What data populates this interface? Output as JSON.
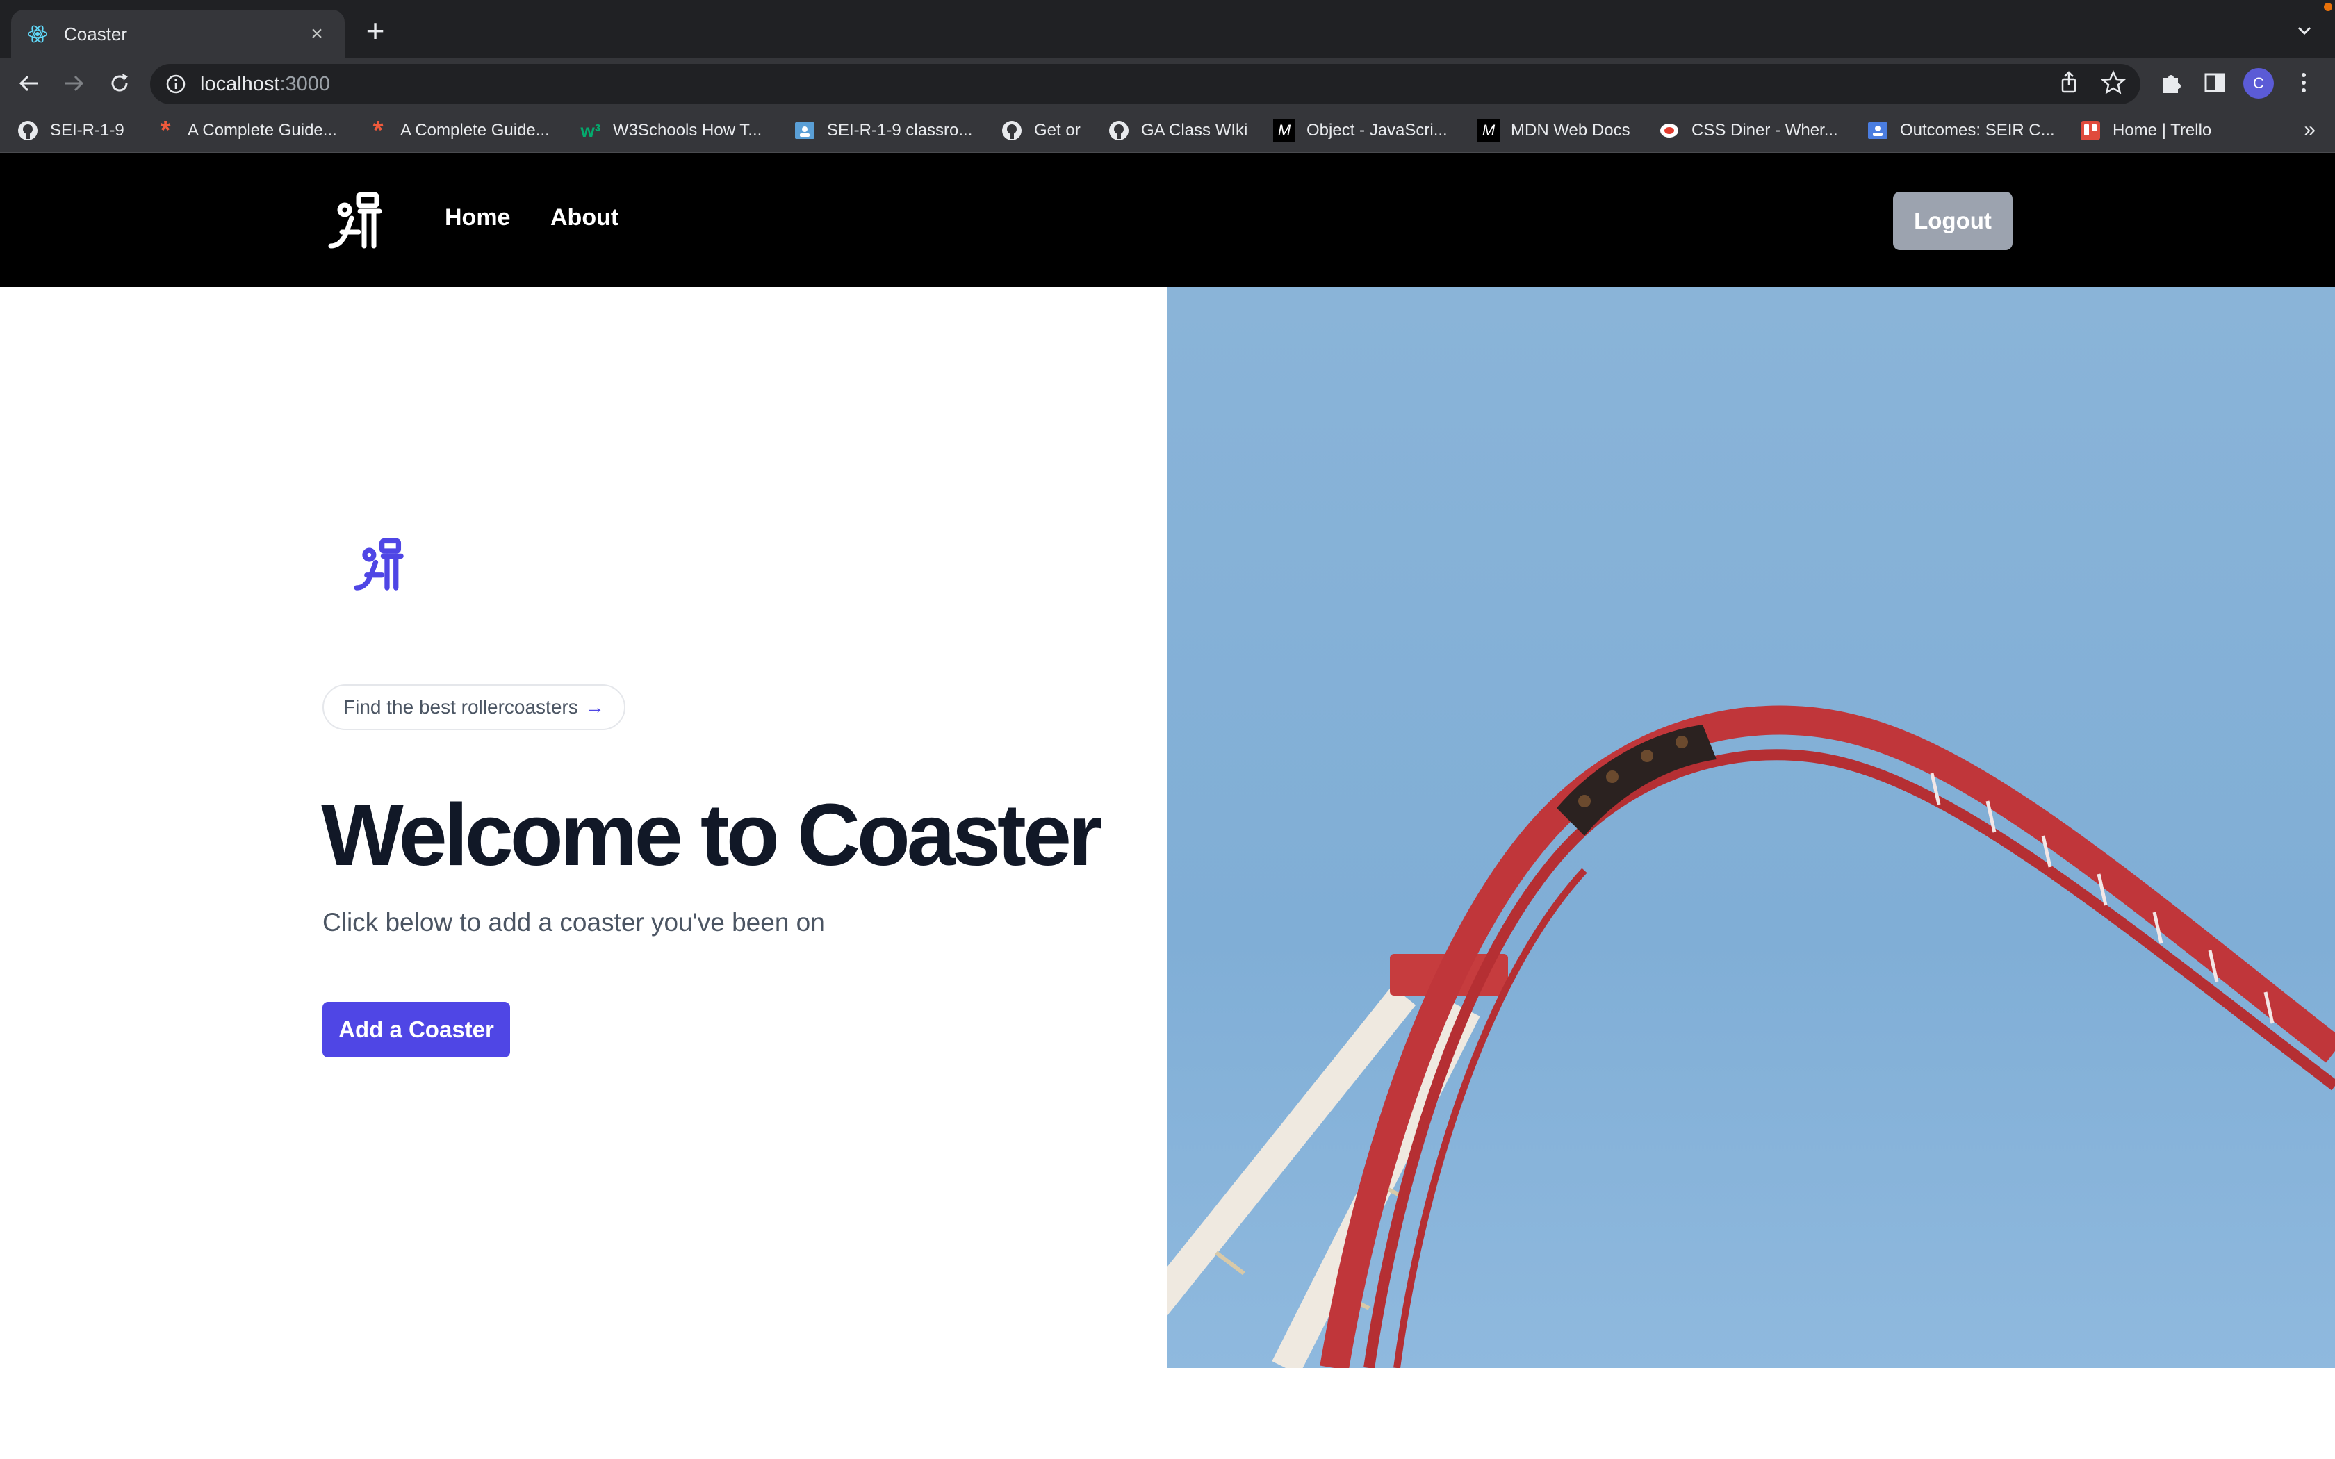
{
  "browser": {
    "tab_title": "Coaster",
    "tab_close": "×",
    "new_tab": "+",
    "url_host": "localhost",
    "url_port": ":3000",
    "profile_initial": "C",
    "bookmarks_more": "»",
    "bookmarks": [
      {
        "label": "SEI-R-1-9",
        "icon": "github-icon"
      },
      {
        "label": "A Complete Guide...",
        "icon": "asterisk-icon"
      },
      {
        "label": "A Complete Guide...",
        "icon": "asterisk-icon"
      },
      {
        "label": "W3Schools How T...",
        "icon": "w3schools-icon"
      },
      {
        "label": "SEI-R-1-9 classro...",
        "icon": "classroom-icon"
      },
      {
        "label": "Get or",
        "icon": "github-icon"
      },
      {
        "label": "GA Class WIki",
        "icon": "github-icon"
      },
      {
        "label": "Object - JavaScri...",
        "icon": "mdn-icon"
      },
      {
        "label": "MDN Web Docs",
        "icon": "mdn-icon"
      },
      {
        "label": "CSS Diner - Wher...",
        "icon": "css-diner-icon"
      },
      {
        "label": "Outcomes: SEIR C...",
        "icon": "outcomes-icon"
      },
      {
        "label": "Home | Trello",
        "icon": "trello-icon"
      }
    ]
  },
  "nav": {
    "links": [
      "Home",
      "About"
    ],
    "logout_label": "Logout"
  },
  "hero": {
    "pill_text": "Find the best rollercoasters",
    "pill_arrow": "→",
    "title": "Welcome to Coaster",
    "subtitle": "Click below to add a coaster you've been on",
    "cta_label": "Add a Coaster"
  },
  "colors": {
    "accent": "#4f46e5",
    "logout_bg": "#9ca3af",
    "navbar_bg": "#000000",
    "sky": "#8ab4d8",
    "track_red": "#c0363a"
  }
}
